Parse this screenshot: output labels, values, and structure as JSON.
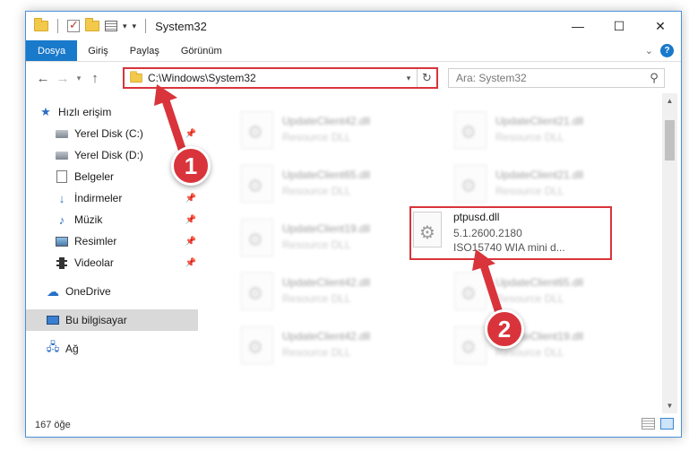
{
  "window": {
    "title": "System32",
    "controls": {
      "minimize": "—",
      "maximize": "☐",
      "close": "✕"
    }
  },
  "ribbon": {
    "tabs": [
      {
        "label": "Dosya",
        "active": true
      },
      {
        "label": "Giriş",
        "active": false
      },
      {
        "label": "Paylaş",
        "active": false
      },
      {
        "label": "Görünüm",
        "active": false
      }
    ],
    "help": "?"
  },
  "navbar": {
    "address": "C:\\Windows\\System32",
    "search_placeholder": "Ara: System32"
  },
  "sidebar": {
    "items": [
      {
        "label": "Hızlı erişim",
        "icon": "star-icon",
        "pinned": false
      },
      {
        "label": "Yerel Disk (C:)",
        "icon": "disk-icon",
        "pinned": true
      },
      {
        "label": "Yerel Disk (D:)",
        "icon": "disk-icon",
        "pinned": false
      },
      {
        "label": "Belgeler",
        "icon": "document-icon",
        "pinned": false
      },
      {
        "label": "İndirmeler",
        "icon": "download-icon",
        "pinned": true
      },
      {
        "label": "Müzik",
        "icon": "music-icon",
        "pinned": true
      },
      {
        "label": "Resimler",
        "icon": "picture-icon",
        "pinned": true
      },
      {
        "label": "Videolar",
        "icon": "video-icon",
        "pinned": true
      },
      {
        "label": "OneDrive",
        "icon": "cloud-icon",
        "pinned": false
      },
      {
        "label": "Bu bilgisayar",
        "icon": "computer-icon",
        "pinned": false,
        "selected": true
      },
      {
        "label": "Ağ",
        "icon": "network-icon",
        "pinned": false
      }
    ]
  },
  "files": [
    {
      "name": "UpdateClient42.dll",
      "desc": "Resource DLL"
    },
    {
      "name": "UpdateClient21.dll",
      "desc": "Resource DLL"
    },
    {
      "name": "UpdateClient65.dll",
      "desc": "Resource DLL"
    },
    {
      "name": "UpdateClient21.dll",
      "desc": "Resource DLL"
    },
    {
      "name": "UpdateClient19.dll",
      "desc": "Resource DLL"
    },
    {
      "name": "UpdateClient42.dll",
      "desc": "Resource DLL"
    },
    {
      "name": "UpdateClient65.dll",
      "desc": "Resource DLL"
    },
    {
      "name": "UpdateClient42.dll",
      "desc": "Resource DLL"
    },
    {
      "name": "UpdateClient19.dll",
      "desc": "Resource DLL"
    }
  ],
  "highlighted_file": {
    "name": "ptpusd.dll",
    "version": "5.1.2600.2180",
    "desc": "ISO15740 WIA mini d..."
  },
  "statusbar": {
    "count": "167 öğe"
  },
  "annotations": {
    "step1": "1",
    "step2": "2",
    "color": "#d9343b"
  }
}
